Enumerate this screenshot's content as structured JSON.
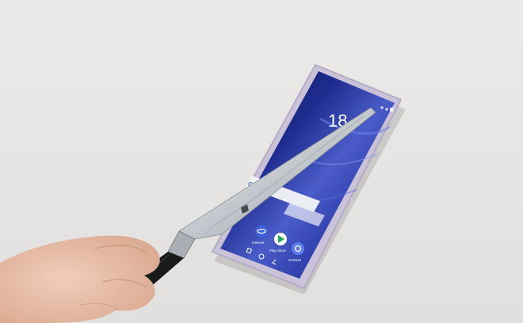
{
  "scene": {
    "colors": {
      "background": "#e7e6e4",
      "phone_body": "#c9c2d8",
      "screen_dark": "#0d1a5e",
      "screen_mid": "#3446b8",
      "blade": "#c8cdd2",
      "handle": "#1a1a1a",
      "skin": "#e8c2ae"
    }
  },
  "phone": {
    "clock_text": "18",
    "search_bar_letter": "G",
    "apps": [
      {
        "label": "Internet",
        "icon": "internet-icon"
      },
      {
        "label": "Play Store",
        "icon": "play-store-icon"
      },
      {
        "label": "Camera",
        "icon": "camera-icon"
      }
    ],
    "nav_icons": [
      "recent-apps-icon",
      "home-icon",
      "back-icon"
    ]
  }
}
